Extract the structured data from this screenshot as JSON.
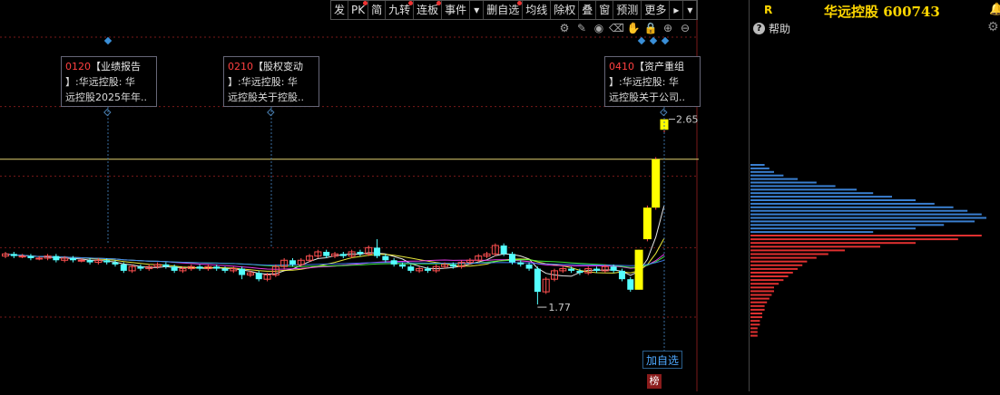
{
  "toolbar": {
    "buttons": [
      "发",
      "PK",
      "简",
      "九转",
      "连板",
      "事件",
      "▾",
      "删自选",
      "均线",
      "除权",
      "叠",
      "窗",
      "预测",
      "更多",
      "▸",
      "▾"
    ]
  },
  "icons": [
    "settings-icon",
    "pencil-icon",
    "eye-icon",
    "trash-icon",
    "hand-icon",
    "lock-icon",
    "zoom-in-icon",
    "zoom-out-icon"
  ],
  "annotations": [
    {
      "code": "0120",
      "type": "【业绩报告",
      "line2": "】:华远控股: 华",
      "line3": "远控股2025年年.."
    },
    {
      "code": "0210",
      "type": "【股权变动",
      "line2": "】:华远控股: 华",
      "line3": "远控股关于控股.."
    },
    {
      "code": "0410",
      "type": "【资产重组",
      "line2": "】:华远控股: 华",
      "line3": "远控股关于公司.."
    }
  ],
  "add_watch_label": "加自选",
  "bang_label": "榜",
  "stock": {
    "badge": "R",
    "title": "华远控股 600743",
    "help": "帮助"
  },
  "colors": {
    "up": "#ffff00",
    "down": "#54ffff",
    "grid": "#7a1a1a",
    "axis": "#ff4444",
    "hline": "#e0d070",
    "ma5": "#ffffff",
    "ma10": "#ffff40",
    "ma20": "#ff40ff",
    "ma30": "#40ff40",
    "ma60": "#4080ff"
  },
  "chart_data": {
    "type": "candlestick",
    "y_ticks": [
      3.04,
      2.71,
      2.38,
      2.04,
      1.71
    ],
    "ylim": [
      1.5,
      3.1
    ],
    "ref_line": 2.46,
    "annotations_marked": [
      {
        "label": "2.65",
        "kind": "high"
      },
      {
        "label": "1.77",
        "kind": "low"
      }
    ],
    "candles": [
      [
        2.0,
        2.01,
        2.02,
        1.99
      ],
      [
        2.01,
        2.0,
        2.02,
        1.99
      ],
      [
        2.0,
        2.0,
        2.01,
        1.99
      ],
      [
        2.0,
        1.99,
        2.01,
        1.98
      ],
      [
        1.99,
        1.99,
        2.0,
        1.98
      ],
      [
        1.99,
        2.0,
        2.01,
        1.98
      ],
      [
        2.0,
        1.98,
        2.01,
        1.97
      ],
      [
        1.98,
        1.99,
        2.0,
        1.97
      ],
      [
        1.99,
        1.98,
        2.0,
        1.97
      ],
      [
        1.98,
        1.98,
        1.99,
        1.97
      ],
      [
        1.98,
        1.97,
        1.99,
        1.96
      ],
      [
        1.97,
        1.98,
        1.99,
        1.96
      ],
      [
        1.98,
        1.97,
        1.99,
        1.96
      ],
      [
        1.97,
        1.96,
        1.98,
        1.95
      ],
      [
        1.96,
        1.93,
        1.97,
        1.92
      ],
      [
        1.93,
        1.95,
        1.96,
        1.92
      ],
      [
        1.95,
        1.94,
        1.96,
        1.93
      ],
      [
        1.94,
        1.95,
        1.96,
        1.93
      ],
      [
        1.95,
        1.96,
        1.97,
        1.94
      ],
      [
        1.96,
        1.95,
        1.97,
        1.94
      ],
      [
        1.95,
        1.93,
        1.96,
        1.92
      ],
      [
        1.93,
        1.94,
        1.95,
        1.92
      ],
      [
        1.94,
        1.95,
        1.96,
        1.93
      ],
      [
        1.95,
        1.94,
        1.96,
        1.93
      ],
      [
        1.94,
        1.95,
        1.96,
        1.93
      ],
      [
        1.95,
        1.94,
        1.96,
        1.93
      ],
      [
        1.94,
        1.93,
        1.95,
        1.92
      ],
      [
        1.93,
        1.94,
        1.95,
        1.92
      ],
      [
        1.94,
        1.91,
        1.95,
        1.89
      ],
      [
        1.91,
        1.92,
        1.93,
        1.9
      ],
      [
        1.92,
        1.89,
        1.93,
        1.88
      ],
      [
        1.89,
        1.91,
        1.92,
        1.88
      ],
      [
        1.91,
        1.95,
        1.96,
        1.9
      ],
      [
        1.95,
        1.98,
        1.99,
        1.94
      ],
      [
        1.98,
        1.96,
        1.99,
        1.95
      ],
      [
        1.96,
        1.98,
        1.99,
        1.95
      ],
      [
        1.98,
        2.0,
        2.01,
        1.97
      ],
      [
        2.0,
        2.02,
        2.03,
        1.99
      ],
      [
        2.02,
        2.0,
        2.03,
        1.99
      ],
      [
        2.0,
        2.01,
        2.02,
        1.99
      ],
      [
        2.01,
        2.0,
        2.02,
        1.99
      ],
      [
        2.0,
        2.02,
        2.03,
        1.99
      ],
      [
        2.02,
        2.01,
        2.03,
        2.0
      ],
      [
        2.01,
        2.04,
        2.05,
        2.0
      ],
      [
        2.04,
        2.0,
        2.08,
        1.99
      ],
      [
        2.0,
        1.98,
        2.01,
        1.97
      ],
      [
        1.98,
        1.96,
        1.99,
        1.95
      ],
      [
        1.96,
        1.95,
        1.97,
        1.94
      ],
      [
        1.95,
        1.93,
        1.96,
        1.92
      ],
      [
        1.93,
        1.94,
        1.95,
        1.92
      ],
      [
        1.94,
        1.93,
        1.95,
        1.92
      ],
      [
        1.93,
        1.95,
        1.96,
        1.92
      ],
      [
        1.95,
        1.96,
        1.97,
        1.94
      ],
      [
        1.96,
        1.95,
        1.97,
        1.94
      ],
      [
        1.95,
        1.97,
        1.98,
        1.94
      ],
      [
        1.97,
        1.98,
        1.99,
        1.96
      ],
      [
        1.98,
        2.0,
        2.01,
        1.97
      ],
      [
        2.0,
        2.01,
        2.02,
        1.99
      ],
      [
        2.01,
        2.05,
        2.06,
        2.0
      ],
      [
        2.05,
        2.01,
        2.06,
        2.0
      ],
      [
        2.01,
        1.97,
        2.02,
        1.96
      ],
      [
        1.97,
        1.96,
        1.98,
        1.95
      ],
      [
        1.96,
        1.94,
        1.97,
        1.93
      ],
      [
        1.94,
        1.83,
        1.95,
        1.77
      ],
      [
        1.83,
        1.89,
        1.9,
        1.82
      ],
      [
        1.89,
        1.93,
        1.94,
        1.88
      ],
      [
        1.93,
        1.94,
        1.95,
        1.92
      ],
      [
        1.94,
        1.93,
        1.95,
        1.92
      ],
      [
        1.93,
        1.92,
        1.94,
        1.91
      ],
      [
        1.92,
        1.94,
        1.95,
        1.91
      ],
      [
        1.94,
        1.93,
        1.95,
        1.92
      ],
      [
        1.93,
        1.95,
        1.96,
        1.92
      ],
      [
        1.95,
        1.93,
        1.96,
        1.92
      ],
      [
        1.93,
        1.89,
        1.94,
        1.88
      ],
      [
        1.89,
        1.84,
        1.9,
        1.83
      ],
      [
        1.84,
        2.03,
        2.03,
        1.84
      ],
      [
        2.08,
        2.23,
        2.24,
        2.07
      ],
      [
        2.23,
        2.46,
        2.47,
        2.22
      ],
      [
        2.6,
        2.65,
        2.65,
        2.58
      ]
    ],
    "ma": {
      "ma5": [
        1.99,
        1.99,
        1.98,
        1.97,
        1.96,
        1.95,
        1.95,
        1.94,
        1.95,
        1.96,
        1.98,
        1.99,
        2.0,
        2.01,
        2.0,
        1.98,
        1.96,
        1.95,
        1.95,
        1.96,
        1.98,
        2.0,
        2.0,
        1.95,
        1.94,
        1.93,
        1.94,
        1.93,
        1.87,
        1.95,
        2.08,
        2.26
      ],
      "ma30": [
        2.06,
        2.05,
        2.04,
        2.03,
        2.02,
        2.01,
        2.0,
        1.99,
        1.99,
        1.98,
        1.98,
        1.98,
        1.98,
        1.98,
        1.98,
        1.97,
        1.97,
        1.97,
        1.97,
        1.97,
        1.97,
        1.97,
        1.97,
        1.96,
        1.96,
        1.96,
        1.96,
        1.96,
        1.95,
        1.96,
        1.97,
        1.98
      ]
    },
    "volume_profile": {
      "up": [
        0.06,
        0.08,
        0.1,
        0.14,
        0.2,
        0.28,
        0.36,
        0.45,
        0.52,
        0.6,
        0.7,
        0.78,
        0.86,
        0.92,
        0.98,
        1.0,
        0.95,
        0.82,
        0.7,
        0.52
      ],
      "down": [
        0.98,
        0.88,
        0.7,
        0.55,
        0.4,
        0.33,
        0.28,
        0.24,
        0.22,
        0.2,
        0.18,
        0.16,
        0.14,
        0.12,
        0.1,
        0.1,
        0.09,
        0.08,
        0.07,
        0.06,
        0.06,
        0.05,
        0.05,
        0.04,
        0.04,
        0.03,
        0.03,
        0.03
      ]
    }
  }
}
